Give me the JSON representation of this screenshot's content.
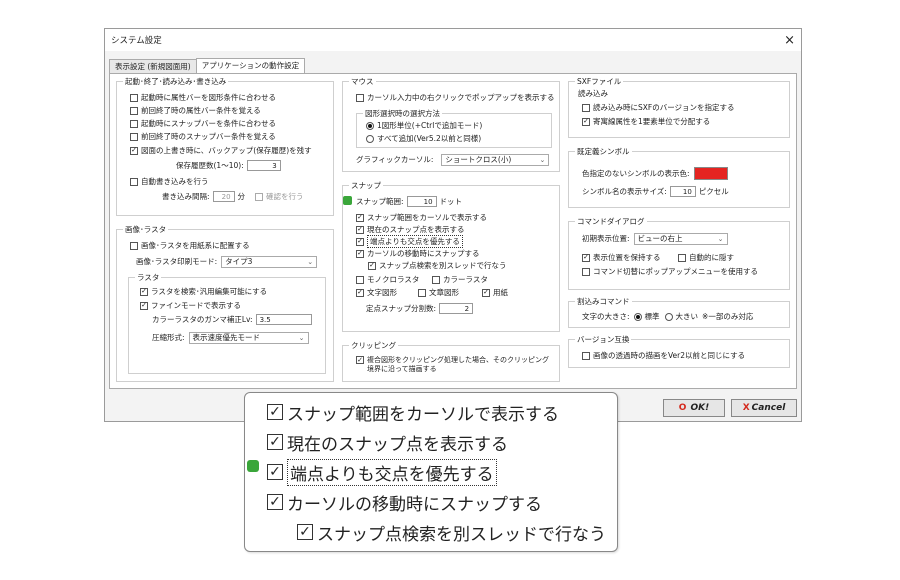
{
  "window": {
    "title": "システム設定",
    "close": "×"
  },
  "tabs": [
    {
      "label": "表示設定 (新規図面用)"
    },
    {
      "label": "アプリケーションの動作設定"
    }
  ],
  "startup": {
    "legend": "起動･終了･読み込み･書き込み",
    "items": [
      {
        "label": "起動時に属性バーを図形条件に合わせる",
        "checked": false
      },
      {
        "label": "前回終了時の属性バー条件を覚える",
        "checked": false
      },
      {
        "label": "起動時にスナップバーを条件に合わせる",
        "checked": false
      },
      {
        "label": "前回終了時のスナップバー条件を覚える",
        "checked": false
      },
      {
        "label": "図面の上書き時に、バックアップ(保存履歴)を残す",
        "checked": true
      }
    ],
    "history_label": "保存履歴数(1〜10):",
    "history_value": "3",
    "autosave_label": "自動書き込みを行う",
    "interval_label": "書き込み間隔:",
    "interval_value": "20",
    "interval_unit": "分",
    "confirm_label": "確認を行う"
  },
  "image_raster": {
    "legend": "画像･ラスタ",
    "place_label": "画像･ラスタを用紙系に配置する",
    "print_mode_label": "画像･ラスタ印刷モード:",
    "print_mode_value": "タイプ3",
    "raster_legend": "ラスタ",
    "search_edit_label": "ラスタを検索･汎用編集可能にする",
    "fine_mode_label": "ファインモードで表示する",
    "gamma_label": "カラーラスタのガンマ補正Lv:",
    "gamma_value": "3.5",
    "compress_label": "圧縮形式:",
    "compress_value": "表示速度優先モード"
  },
  "mouse": {
    "legend": "マウス",
    "popup_label": "カーソル入力中の右クリックでポップアップを表示する",
    "select_method_legend": "図形選択時の選択方法",
    "radio1": "1図形単位(+Ctrlで追加モード)",
    "radio2": "すべて追加(Ver5.2以前と同様)",
    "cursor_label": "グラフィックカーソル:",
    "cursor_value": "ショートクロス(小)"
  },
  "snap": {
    "legend": "スナップ",
    "range_label": "スナップ範囲:",
    "range_value": "10",
    "range_unit": "ドット",
    "items": [
      {
        "label": "スナップ範囲をカーソルで表示する",
        "checked": true
      },
      {
        "label": "現在のスナップ点を表示する",
        "checked": true
      },
      {
        "label": "端点よりも交点を優先する",
        "checked": true
      },
      {
        "label": "カーソルの移動時にスナップする",
        "checked": true
      }
    ],
    "thread_label": "スナップ点検索を別スレッドで行なう",
    "mono_label": "モノクロラスタ",
    "color_label": "カラーラスタ",
    "text_shape_label": "文字図形",
    "text_frame_label": "文章図形",
    "paper_label": "用紙",
    "fixed_label": "定点スナップ分割数:",
    "fixed_value": "2"
  },
  "clipping": {
    "legend": "クリッピング",
    "label_line1": "複合図形をクリッピング処理した場合、そのクリッピング",
    "label_line2": "境界に沿って描画する"
  },
  "sxf": {
    "legend": "SXFファイル",
    "read_legend": "読み込み",
    "version_label": "読み込み時にSXFのバージョンを指定する",
    "split_label": "寄寓線属性を1要素単位で分配する"
  },
  "symbol": {
    "legend": "既定義シンボル",
    "undefined_color_label": "色指定のないシンボルの表示色:",
    "undefined_color": "#e52421",
    "name_size_label": "シンボル名の表示サイズ:",
    "name_size_value": "10",
    "name_size_unit": "ピクセル"
  },
  "command_dialog": {
    "legend": "コマンドダイアログ",
    "initial_pos_label": "初期表示位置:",
    "initial_pos_value": "ビューの右上",
    "keep_pos_label": "表示位置を保持する",
    "auto_hide_label": "自動的に隠す",
    "popup_menu_label": "コマンド切替にポップアップメニューを使用する"
  },
  "command_input": {
    "legend": "割込みコマンド",
    "size_label": "文字の大きさ:",
    "opt_standard": "標準",
    "opt_large": "大きい",
    "note": "※一部のみ対応"
  },
  "compat": {
    "legend": "バージョン互換",
    "label": "画像の透過時の描画をVer2以前と同じにする"
  },
  "buttons": {
    "ok": "OK!",
    "ok_icon": "O",
    "cancel": "Cancel",
    "cancel_icon": "X"
  },
  "zoom": {
    "items": [
      {
        "label": "スナップ範囲をカーソルで表示する"
      },
      {
        "label": "現在のスナップ点を表示する"
      },
      {
        "label": "端点よりも交点を優先する"
      },
      {
        "label": "カーソルの移動時にスナップする"
      },
      {
        "label": "スナップ点検索を別スレッドで行なう"
      }
    ]
  },
  "colors": {
    "accent_green": "#3aa63a",
    "ok_red": "#d4281c"
  }
}
